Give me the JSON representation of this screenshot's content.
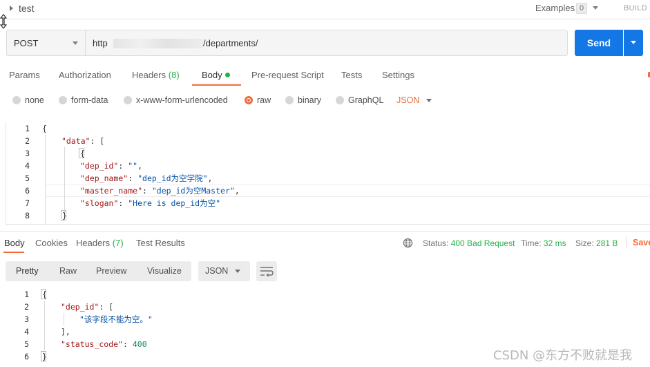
{
  "header": {
    "request_name": "test",
    "examples_label": "Examples",
    "examples_count": "0",
    "build_label": "BUILD"
  },
  "url_bar": {
    "method": "POST",
    "url_prefix": "http",
    "url_suffix": "/departments/",
    "send_label": "Send"
  },
  "request_tabs": [
    {
      "label": "Params"
    },
    {
      "label": "Authorization"
    },
    {
      "label": "Headers",
      "count": "(8)"
    },
    {
      "label": "Body",
      "active": true
    },
    {
      "label": "Pre-request Script"
    },
    {
      "label": "Tests"
    },
    {
      "label": "Settings"
    }
  ],
  "body_types": {
    "options": [
      "none",
      "form-data",
      "x-www-form-urlencoded",
      "raw",
      "binary",
      "GraphQL"
    ],
    "selected": "raw",
    "format": "JSON"
  },
  "request_body": {
    "line_numbers": [
      "1",
      "2",
      "3",
      "4",
      "5",
      "6",
      "7",
      "8"
    ],
    "l1": "{",
    "l2_key": "\"data\"",
    "l2_rest": ": [",
    "l3": "{",
    "l4_key": "\"dep_id\"",
    "l4_val": "\"\"",
    "l5_key": "\"dep_name\"",
    "l5_val": "\"dep_id为空学院\"",
    "l6_key": "\"master_name\"",
    "l6_val": "\"dep_id为空Master\"",
    "l7_key": "\"slogan\"",
    "l7_val": "\"Here is dep_id为空\"",
    "l8": "}"
  },
  "response_tabs": [
    {
      "label": "Body",
      "active": true
    },
    {
      "label": "Cookies"
    },
    {
      "label": "Headers",
      "count": "(7)"
    },
    {
      "label": "Test Results"
    }
  ],
  "response_status": {
    "status_label": "Status:",
    "status_value": "400 Bad Request",
    "time_label": "Time:",
    "time_value": "32 ms",
    "size_label": "Size:",
    "size_value": "281 B",
    "save_label": "Save"
  },
  "response_view": {
    "modes": [
      "Pretty",
      "Raw",
      "Preview",
      "Visualize"
    ],
    "active_mode": "Pretty",
    "format": "JSON"
  },
  "response_body": {
    "line_numbers": [
      "1",
      "2",
      "3",
      "4",
      "5",
      "6"
    ],
    "l1": "{",
    "l2_key": "\"dep_id\"",
    "l2_rest": ": [",
    "l3_val": "\"该字段不能为空。\"",
    "l4": "],",
    "l5_key": "\"status_code\"",
    "l5_val": "400",
    "l6": "}"
  },
  "watermark": "CSDN @东方不败就是我",
  "colors": {
    "accent": "#f26b3a",
    "send_blue": "#1477e6",
    "success_green": "#26b047"
  }
}
